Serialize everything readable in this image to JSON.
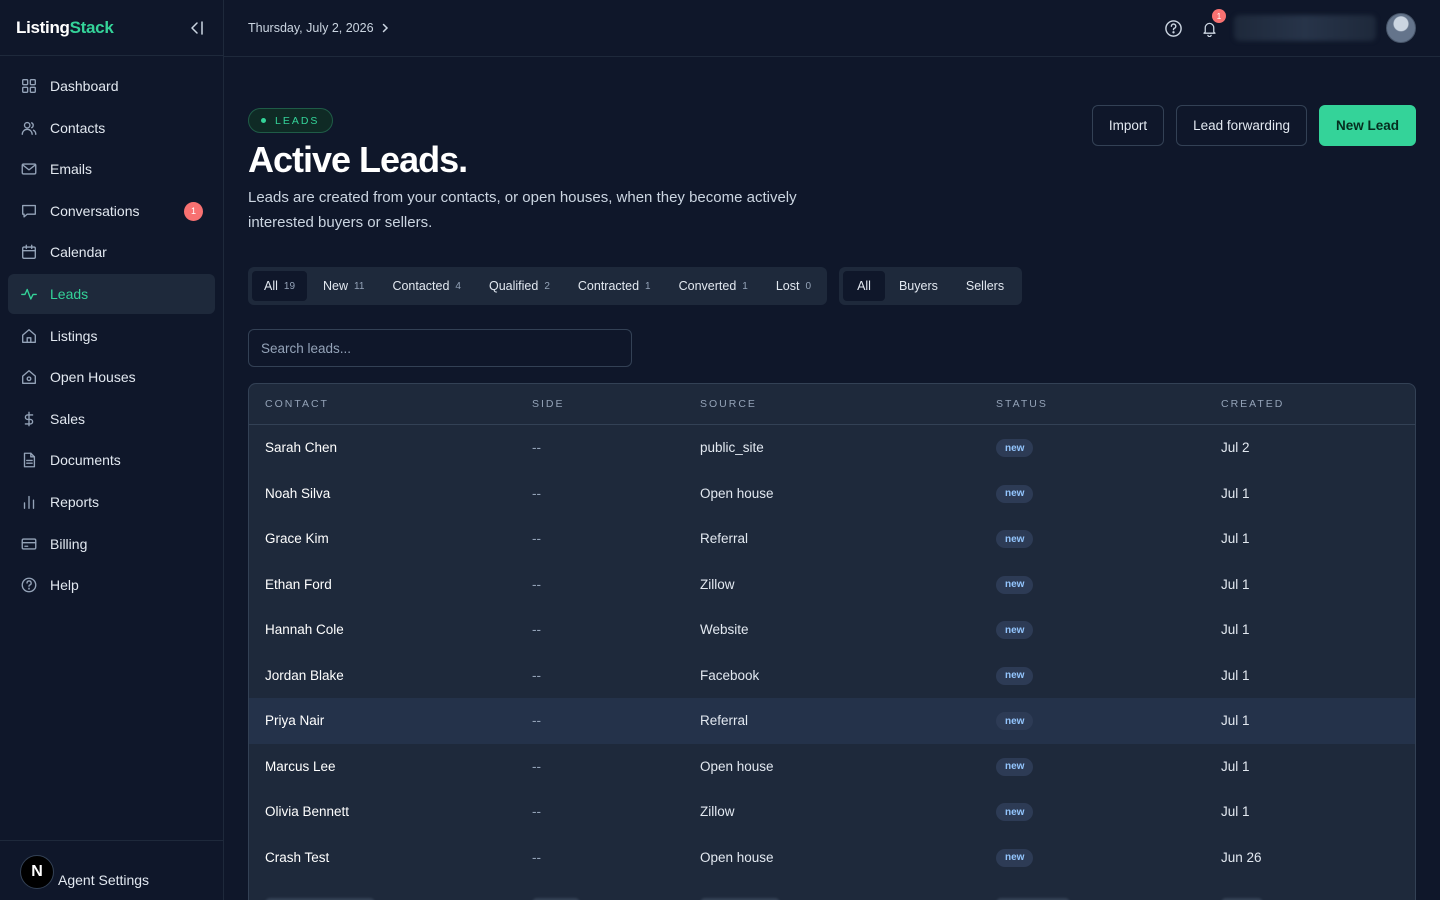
{
  "app": {
    "brand_prefix": "Listing",
    "brand_suffix": "Stack",
    "colors": {
      "accent": "#34d399",
      "background": "#0f172a",
      "surface": "#1e293b",
      "badge": "#f87171"
    }
  },
  "sidebar": {
    "items": [
      {
        "label": "Dashboard",
        "icon": "grid-icon"
      },
      {
        "label": "Contacts",
        "icon": "users-icon"
      },
      {
        "label": "Emails",
        "icon": "mail-icon"
      },
      {
        "label": "Conversations",
        "icon": "chat-icon",
        "badge": "1"
      },
      {
        "label": "Calendar",
        "icon": "calendar-icon"
      },
      {
        "label": "Leads",
        "icon": "activity-icon",
        "active": true
      },
      {
        "label": "Listings",
        "icon": "home-icon"
      },
      {
        "label": "Open Houses",
        "icon": "house-icon"
      },
      {
        "label": "Sales",
        "icon": "dollar-icon"
      },
      {
        "label": "Documents",
        "icon": "document-icon"
      },
      {
        "label": "Reports",
        "icon": "bar-chart-icon"
      },
      {
        "label": "Billing",
        "icon": "credit-card-icon"
      },
      {
        "label": "Help",
        "icon": "help-icon"
      }
    ],
    "footer": {
      "avatar_letter": "N",
      "label": "Agent Settings"
    }
  },
  "topbar": {
    "date": "Thursday, July 2, 2026",
    "notification_count": "1"
  },
  "page": {
    "pill": "LEADS",
    "title": "Active Leads.",
    "description": "Leads are created from your contacts, or open houses, when they become actively interested buyers or sellers.",
    "actions": {
      "import": "Import",
      "forwarding": "Lead forwarding",
      "new_lead": "New Lead"
    },
    "status_filters": [
      {
        "label": "All",
        "count": "19",
        "active": true
      },
      {
        "label": "New",
        "count": "11"
      },
      {
        "label": "Contacted",
        "count": "4"
      },
      {
        "label": "Qualified",
        "count": "2"
      },
      {
        "label": "Contracted",
        "count": "1"
      },
      {
        "label": "Converted",
        "count": "1"
      },
      {
        "label": "Lost",
        "count": "0"
      }
    ],
    "side_filters": [
      {
        "label": "All",
        "active": true
      },
      {
        "label": "Buyers"
      },
      {
        "label": "Sellers"
      }
    ],
    "search_placeholder": "Search leads..."
  },
  "table": {
    "columns": [
      "CONTACT",
      "SIDE",
      "SOURCE",
      "STATUS",
      "CREATED"
    ],
    "rows": [
      {
        "contact": "Sarah Chen",
        "side": "--",
        "source": "public_site",
        "status": "new",
        "created": "Jul 2"
      },
      {
        "contact": "Noah Silva",
        "side": "--",
        "source": "Open house",
        "status": "new",
        "created": "Jul 1"
      },
      {
        "contact": "Grace Kim",
        "side": "--",
        "source": "Referral",
        "status": "new",
        "created": "Jul 1"
      },
      {
        "contact": "Ethan Ford",
        "side": "--",
        "source": "Zillow",
        "status": "new",
        "created": "Jul 1"
      },
      {
        "contact": "Hannah Cole",
        "side": "--",
        "source": "Website",
        "status": "new",
        "created": "Jul 1"
      },
      {
        "contact": "Jordan Blake",
        "side": "--",
        "source": "Facebook",
        "status": "new",
        "created": "Jul 1"
      },
      {
        "contact": "Priya Nair",
        "side": "--",
        "source": "Referral",
        "status": "new",
        "created": "Jul 1",
        "highlight": true
      },
      {
        "contact": "Marcus Lee",
        "side": "--",
        "source": "Open house",
        "status": "new",
        "created": "Jul 1"
      },
      {
        "contact": "Olivia Bennett",
        "side": "--",
        "source": "Zillow",
        "status": "new",
        "created": "Jul 1"
      },
      {
        "contact": "Crash Test",
        "side": "--",
        "source": "Open house",
        "status": "new",
        "created": "Jun 26"
      }
    ]
  }
}
